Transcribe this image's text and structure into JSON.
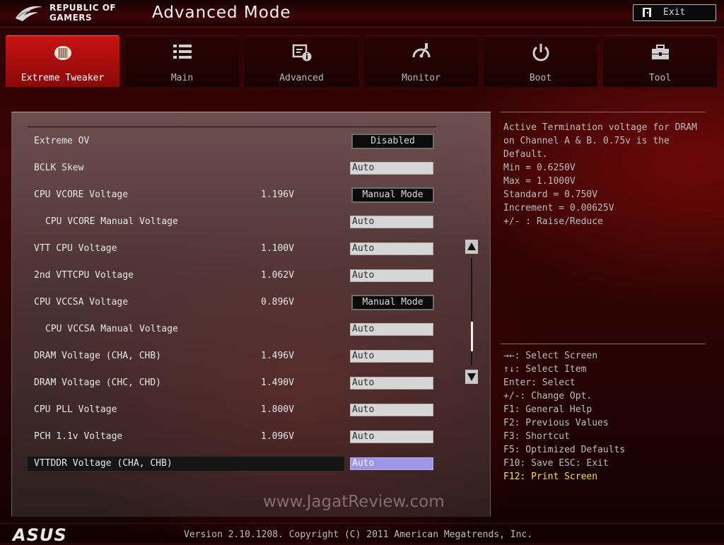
{
  "header": {
    "brand_line1": "REPUBLIC OF",
    "brand_line2": "GAMERS",
    "title": "Advanced Mode",
    "exit_label": "Exit"
  },
  "tabs": [
    {
      "label": "Extreme Tweaker",
      "icon": "tweaker-icon",
      "active": true
    },
    {
      "label": "Main",
      "icon": "list-icon",
      "active": false
    },
    {
      "label": "Advanced",
      "icon": "advanced-info-icon",
      "active": false
    },
    {
      "label": "Monitor",
      "icon": "gauge-icon",
      "active": false
    },
    {
      "label": "Boot",
      "icon": "power-icon",
      "active": false
    },
    {
      "label": "Tool",
      "icon": "toolbox-icon",
      "active": false
    }
  ],
  "settings": [
    {
      "label": "Extreme OV",
      "reading": "",
      "control": "Disabled",
      "type": "select"
    },
    {
      "label": "BCLK Skew",
      "reading": "",
      "control": "Auto",
      "type": "field"
    },
    {
      "label": "CPU VCORE Voltage",
      "reading": "1.196V",
      "control": "Manual Mode",
      "type": "select"
    },
    {
      "label": "CPU VCORE Manual Voltage",
      "reading": "",
      "control": "Auto",
      "type": "field",
      "sub": true
    },
    {
      "label": "VTT CPU Voltage",
      "reading": "1.100V",
      "control": "Auto",
      "type": "field"
    },
    {
      "label": "2nd VTTCPU Voltage",
      "reading": "1.062V",
      "control": "Auto",
      "type": "field"
    },
    {
      "label": "CPU VCCSA Voltage",
      "reading": "0.896V",
      "control": "Manual Mode",
      "type": "select"
    },
    {
      "label": "CPU VCCSA Manual Voltage",
      "reading": "",
      "control": "Auto",
      "type": "field",
      "sub": true
    },
    {
      "label": "DRAM Voltage (CHA, CHB)",
      "reading": "1.496V",
      "control": "Auto",
      "type": "field"
    },
    {
      "label": "DRAM Voltage (CHC, CHD)",
      "reading": "1.490V",
      "control": "Auto",
      "type": "field"
    },
    {
      "label": "CPU PLL Voltage",
      "reading": "1.800V",
      "control": "Auto",
      "type": "field"
    },
    {
      "label": "PCH 1.1v Voltage",
      "reading": "1.096V",
      "control": "Auto",
      "type": "field"
    },
    {
      "label": "VTTDDR Voltage (CHA, CHB)",
      "reading": "",
      "control": "Auto",
      "type": "field",
      "selected": true
    }
  ],
  "help": {
    "lines": [
      "Active Termination voltage for DRAM",
      "on Channel A & B. 0.75v is the",
      "Default.",
      "Min = 0.6250V",
      "Max = 1.1000V",
      "Standard = 0.750V",
      "Increment =  0.00625V",
      "+/- : Raise/Reduce"
    ]
  },
  "keys": [
    {
      "text": "→←: Select Screen",
      "highlight": false
    },
    {
      "text": "↑↓: Select Item",
      "highlight": false
    },
    {
      "text": "Enter: Select",
      "highlight": false
    },
    {
      "text": "+/-: Change Opt.",
      "highlight": false
    },
    {
      "text": "F1: General Help",
      "highlight": false
    },
    {
      "text": "F2: Previous Values",
      "highlight": false
    },
    {
      "text": "F3: Shortcut",
      "highlight": false
    },
    {
      "text": "F5: Optimized Defaults",
      "highlight": false
    },
    {
      "text": "F10: Save  ESC: Exit",
      "highlight": false
    },
    {
      "text": "F12: Print Screen",
      "highlight": true
    }
  ],
  "watermark": "www.JagatReview.com",
  "footer": {
    "brand": "ASUS",
    "version": "Version 2.10.1208. Copyright (C) 2011 American Megatrends, Inc."
  },
  "colors": {
    "accent_red": "#c71414",
    "highlight_field": "#9f95e6",
    "key_highlight": "#f5e14a"
  }
}
